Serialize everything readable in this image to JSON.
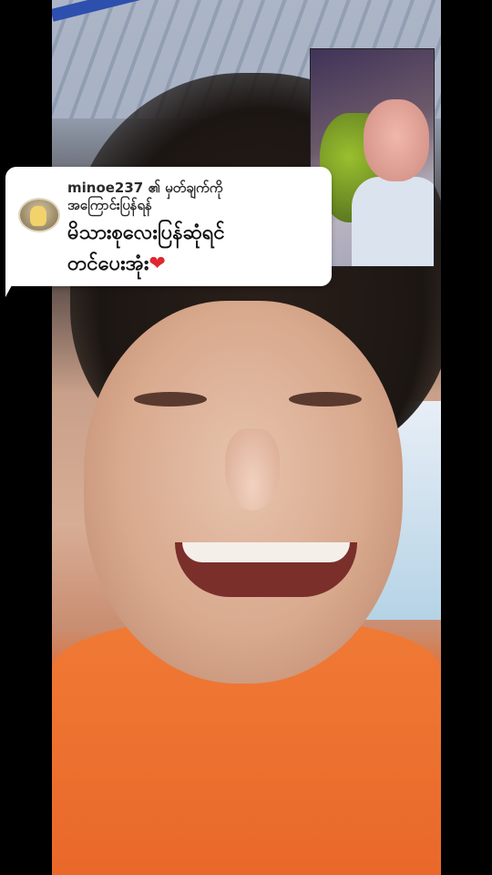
{
  "reply_comment": {
    "username": "minoe237",
    "header_suffix": "၏ မှတ်ချက်ကို",
    "header_line2": "အကြောင်းပြန်ရန်",
    "body_line1": "မိသားစုလေးပြန်ဆုံရင်",
    "body_line2": "တင်ပေးအုံး",
    "emoji_icon": "heart-icon",
    "heart_glyph": "❤",
    "heart_color": "#e02632"
  },
  "pip_video": {
    "icon": "baby-video-thumbnail"
  },
  "main_video": {
    "shirt_color": "#ef7a36"
  }
}
